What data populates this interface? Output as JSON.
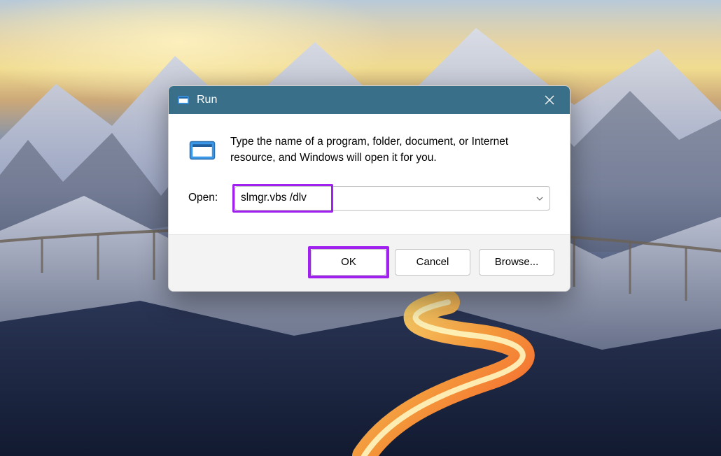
{
  "dialog": {
    "title": "Run",
    "instruction": "Type the name of a program, folder, document, or Internet resource, and Windows will open it for you.",
    "open_label": "Open:",
    "input_value": "slmgr.vbs /dlv",
    "buttons": {
      "ok": "OK",
      "cancel": "Cancel",
      "browse": "Browse..."
    }
  },
  "colors": {
    "highlight": "#a020f0",
    "titlebar": "#3a6f8a"
  }
}
